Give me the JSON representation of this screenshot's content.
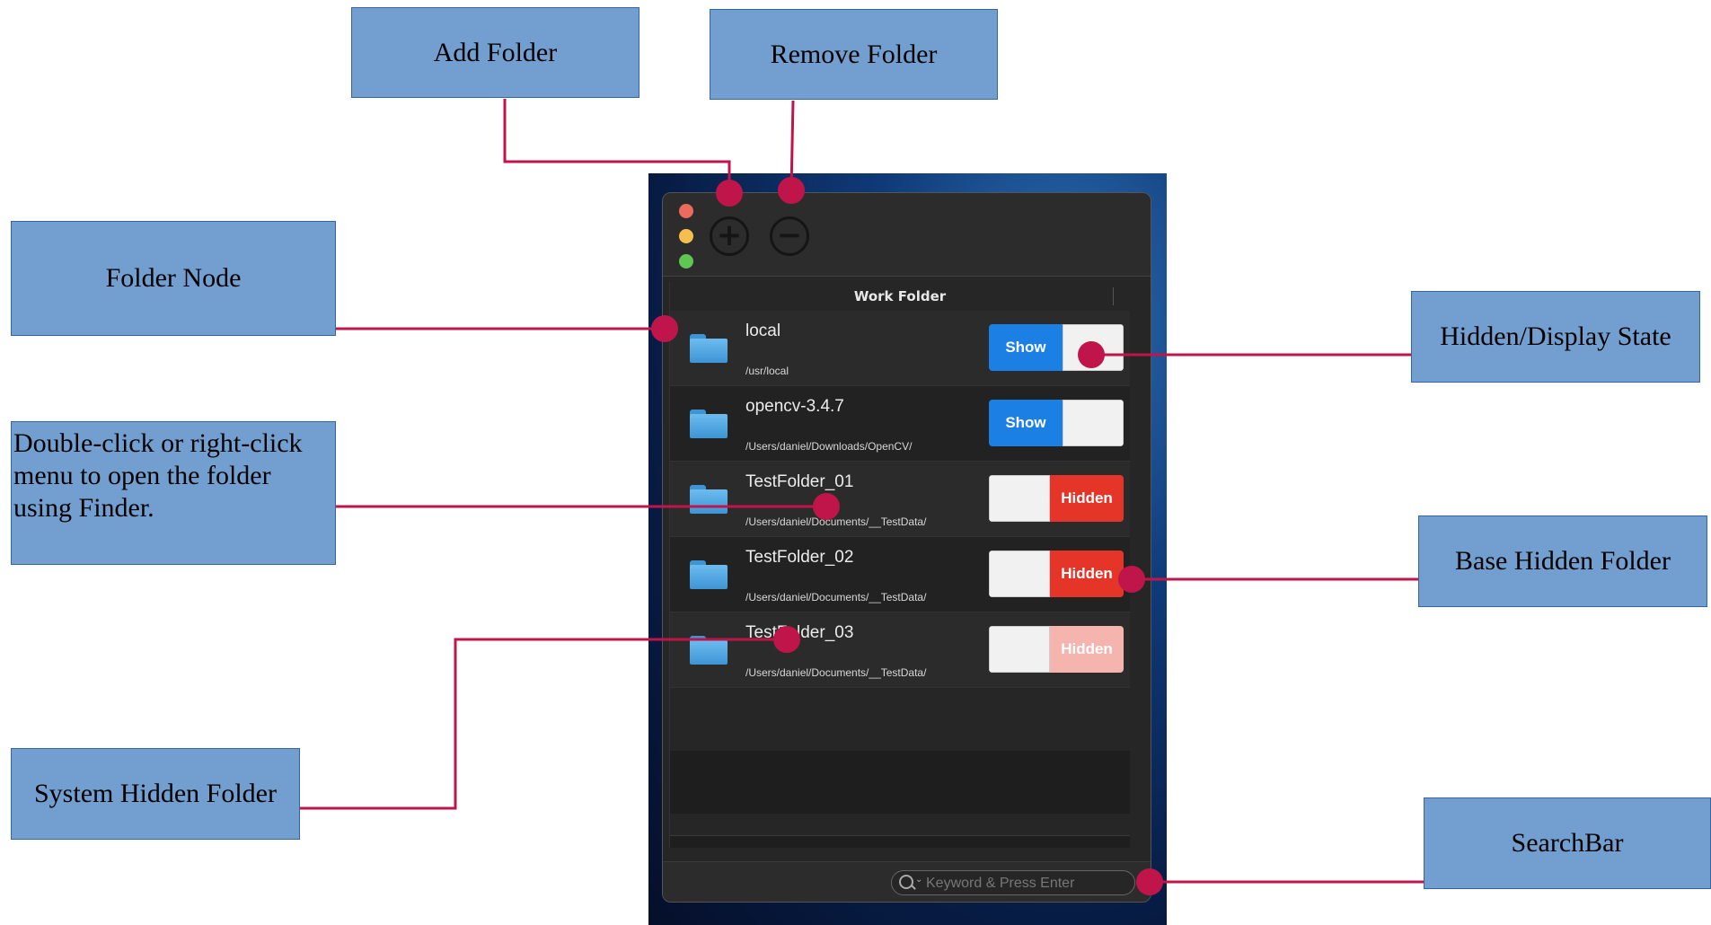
{
  "callouts": {
    "add_folder": "Add Folder",
    "remove_folder": "Remove Folder",
    "folder_node": "Folder Node",
    "double_click_line1": "Double-click or right-click",
    "double_click_line2": "menu to open the folder",
    "double_click_line3": "using Finder.",
    "hidden_display_state": "Hidden/Display State",
    "base_hidden_folder": "Base Hidden Folder",
    "system_hidden_folder": "System Hidden Folder",
    "search_bar": "SearchBar"
  },
  "window": {
    "add_icon": "+",
    "remove_icon": "−",
    "column_header": "Work Folder"
  },
  "rows": [
    {
      "name": "local",
      "path": "/usr/local",
      "state": "Show"
    },
    {
      "name": "opencv-3.4.7",
      "path": "/Users/daniel/Downloads/OpenCV/",
      "state": "Show"
    },
    {
      "name": "TestFolder_01",
      "path": "/Users/daniel/Documents/__TestData/",
      "state": "Hidden"
    },
    {
      "name": "TestFolder_02",
      "path": "/Users/daniel/Documents/__TestData/",
      "state": "Hidden"
    },
    {
      "name": "TestFolder_03",
      "path": "/Users/daniel/Documents/__TestData/",
      "state": "Hidden"
    }
  ],
  "search": {
    "placeholder": "Keyword & Press Enter",
    "chevron": "⌄"
  },
  "colors": {
    "callout_fill": "#729fcf",
    "connector": "#c0154a",
    "show_blue": "#1b7fe3",
    "hidden_red": "#e53528",
    "system_hidden_pink": "#f5b4ae"
  }
}
